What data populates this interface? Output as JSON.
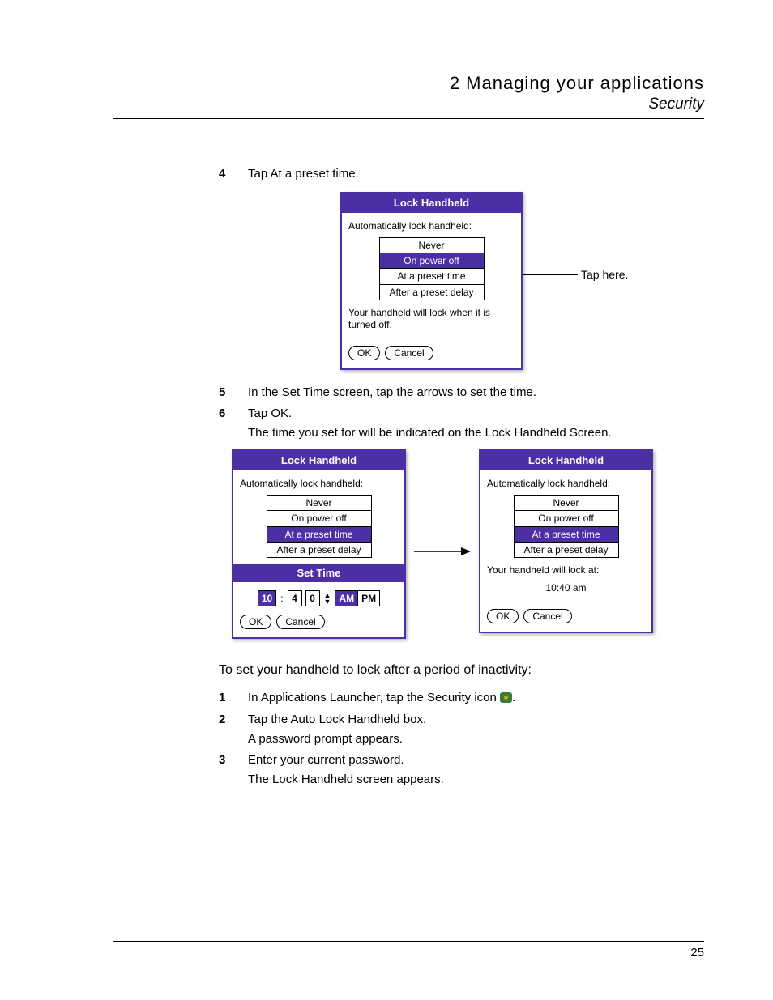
{
  "header": {
    "chapter": "2 Managing your applications",
    "section": "Security"
  },
  "stepsA": [
    {
      "num": "4",
      "text": "Tap At a preset time."
    }
  ],
  "fig1": {
    "title": "Lock Handheld",
    "label": "Automatically lock handheld:",
    "options": [
      "Never",
      "On power off",
      "At a preset time",
      "After a preset delay"
    ],
    "selected": "On power off",
    "desc": "Your handheld will lock when it is turned off.",
    "ok": "OK",
    "cancel": "Cancel",
    "callout": "Tap here."
  },
  "stepsB": [
    {
      "num": "5",
      "text": "In the Set Time screen, tap the arrows to set the time."
    },
    {
      "num": "6",
      "text": "Tap OK.",
      "sub": "The time you set for will be indicated on the Lock Handheld Screen."
    }
  ],
  "fig2": {
    "title": "Lock Handheld",
    "label": "Automatically lock handheld:",
    "options": [
      "Never",
      "On power off",
      "At a preset time",
      "After a preset delay"
    ],
    "selected": "At a preset time",
    "subTitle": "Set Time",
    "hour": "10",
    "min1": "4",
    "min2": "0",
    "am": "AM",
    "pm": "PM",
    "ok": "OK",
    "cancel": "Cancel"
  },
  "fig3": {
    "title": "Lock Handheld",
    "label": "Automatically lock handheld:",
    "options": [
      "Never",
      "On power off",
      "At a preset time",
      "After a preset delay"
    ],
    "selected": "At a preset time",
    "desc": "Your handheld will lock at:",
    "time": "10:40 am",
    "ok": "OK",
    "cancel": "Cancel"
  },
  "subsection": "To set your handheld to lock after a period of inactivity:",
  "stepsC": [
    {
      "num": "1",
      "text": "In Applications Launcher, tap the Security icon ",
      "icon": true,
      "tail": "."
    },
    {
      "num": "2",
      "text": "Tap the Auto Lock Handheld box.",
      "sub": "A password prompt appears."
    },
    {
      "num": "3",
      "text": "Enter your current password.",
      "sub": "The Lock Handheld screen appears."
    }
  ],
  "pageNumber": "25"
}
